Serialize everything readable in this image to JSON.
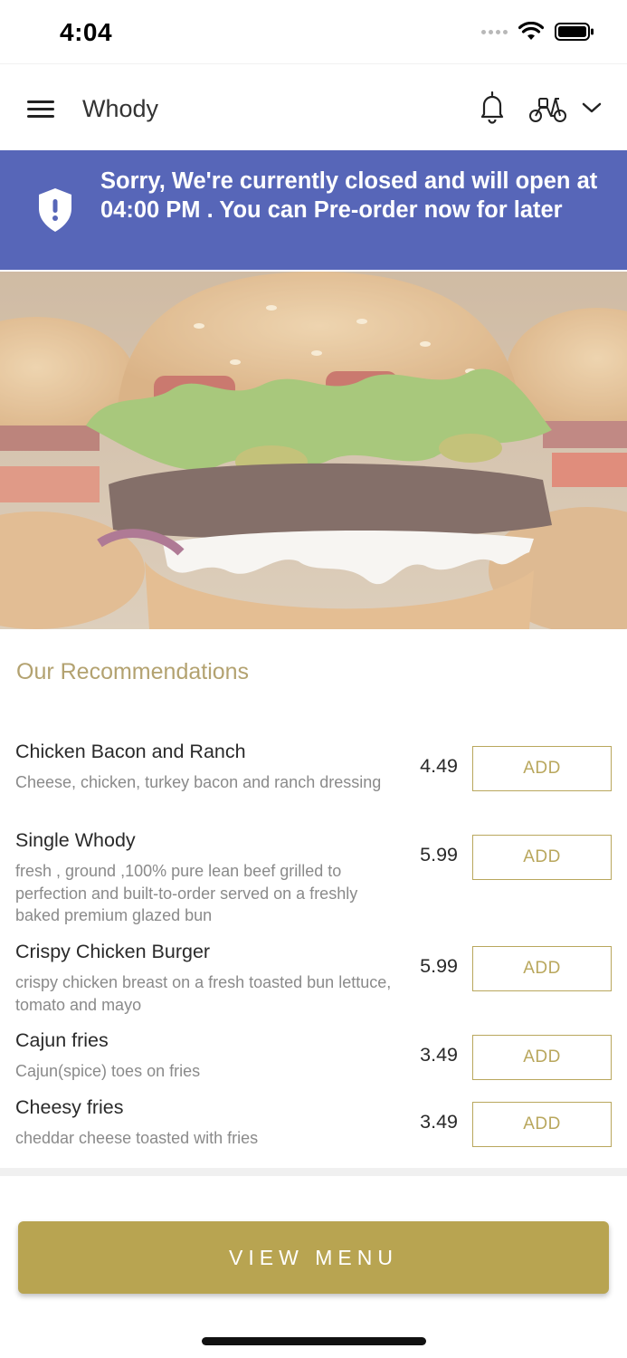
{
  "status_bar": {
    "time": "4:04",
    "icons": [
      "signal-icon",
      "wifi-icon",
      "battery-icon"
    ]
  },
  "header": {
    "title": "Whody",
    "icons": [
      "menu-icon",
      "bell-icon",
      "scooter-icon",
      "chevron-down-icon"
    ]
  },
  "banner": {
    "text": "Sorry, We're currently closed and will open at 04:00 PM . You can Pre-order now for later",
    "icon": "shield-alert-icon",
    "background": "#5766b8"
  },
  "hero": {
    "icon": "burger-image"
  },
  "recommendations": {
    "title": "Our Recommendations",
    "items": [
      {
        "name": "Chicken Bacon and Ranch",
        "description": "Cheese, chicken, turkey bacon and ranch dressing",
        "price": "4.49",
        "button": "ADD"
      },
      {
        "name": "Single Whody",
        "description": "fresh , ground ,100% pure lean beef grilled to perfection and built-to-order served on a freshly baked premium glazed bun",
        "price": "5.99",
        "button": "ADD"
      },
      {
        "name": "Crispy Chicken Burger",
        "description": "crispy chicken breast on a fresh toasted bun lettuce, tomato and mayo",
        "price": "5.99",
        "button": "ADD"
      },
      {
        "name": "Cajun fries",
        "description": "Cajun(spice) toes on fries",
        "price": "3.49",
        "button": "ADD"
      },
      {
        "name": "Cheesy fries",
        "description": "cheddar cheese toasted with fries",
        "price": "3.49",
        "button": "ADD"
      }
    ]
  },
  "footer": {
    "view_menu_label": "VIEW MENU"
  },
  "colors": {
    "accent": "#b8a451",
    "banner": "#5766b8",
    "section_title": "#b3a270"
  }
}
